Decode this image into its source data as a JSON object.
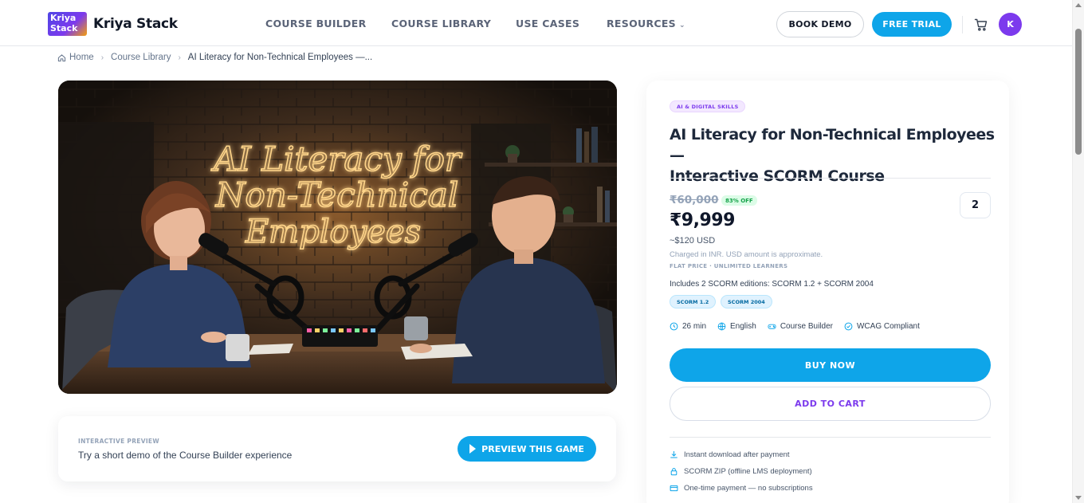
{
  "brand": {
    "mark_line1": "Kriya",
    "mark_line2": "Stack",
    "name": "Kriya Stack"
  },
  "nav": {
    "items": [
      "COURSE BUILDER",
      "COURSE LIBRARY",
      "USE CASES",
      "RESOURCES"
    ]
  },
  "header_actions": {
    "demo": "BOOK DEMO",
    "trial": "FREE TRIAL",
    "avatar_initial": "K"
  },
  "breadcrumb": {
    "home": "Home",
    "library": "Course Library",
    "current": "AI Literacy for Non-Technical Employees —..."
  },
  "hero": {
    "neon_line1": "AI Literacy for",
    "neon_line2": "Non-Technical",
    "neon_line3": "Employees"
  },
  "preview": {
    "kicker": "INTERACTIVE PREVIEW",
    "description": "Try a short demo of the Course Builder experience",
    "button": "PREVIEW THIS GAME"
  },
  "product": {
    "category": "AI & DIGITAL SKILLS",
    "title_line1": "AI Literacy for Non-Technical Employees —",
    "title_line2": "Interactive SCORM Course",
    "old_price": "₹60,000",
    "discount": "83% OFF",
    "price": "₹9,999",
    "usd": "~$120 USD",
    "charged_note": "Charged in INR. USD amount is approximate.",
    "flat_note": "FLAT PRICE · UNLIMITED LEARNERS",
    "quantity": "2",
    "includes": "Includes 2 SCORM editions: SCORM 1.2 + SCORM 2004",
    "editions": [
      "SCORM 1.2",
      "SCORM 2004"
    ],
    "meta": {
      "duration": "26 min",
      "language": "English",
      "tool": "Course Builder",
      "compliance": "WCAG Compliant"
    },
    "buy_now": "BUY NOW",
    "add_to_cart": "ADD TO CART",
    "features": [
      "Instant download after payment",
      "SCORM ZIP (offline LMS deployment)",
      "One-time payment — no subscriptions"
    ]
  },
  "colors": {
    "accent": "#0ea5e9",
    "purple": "#7c3aed",
    "text": "#1e293b"
  }
}
